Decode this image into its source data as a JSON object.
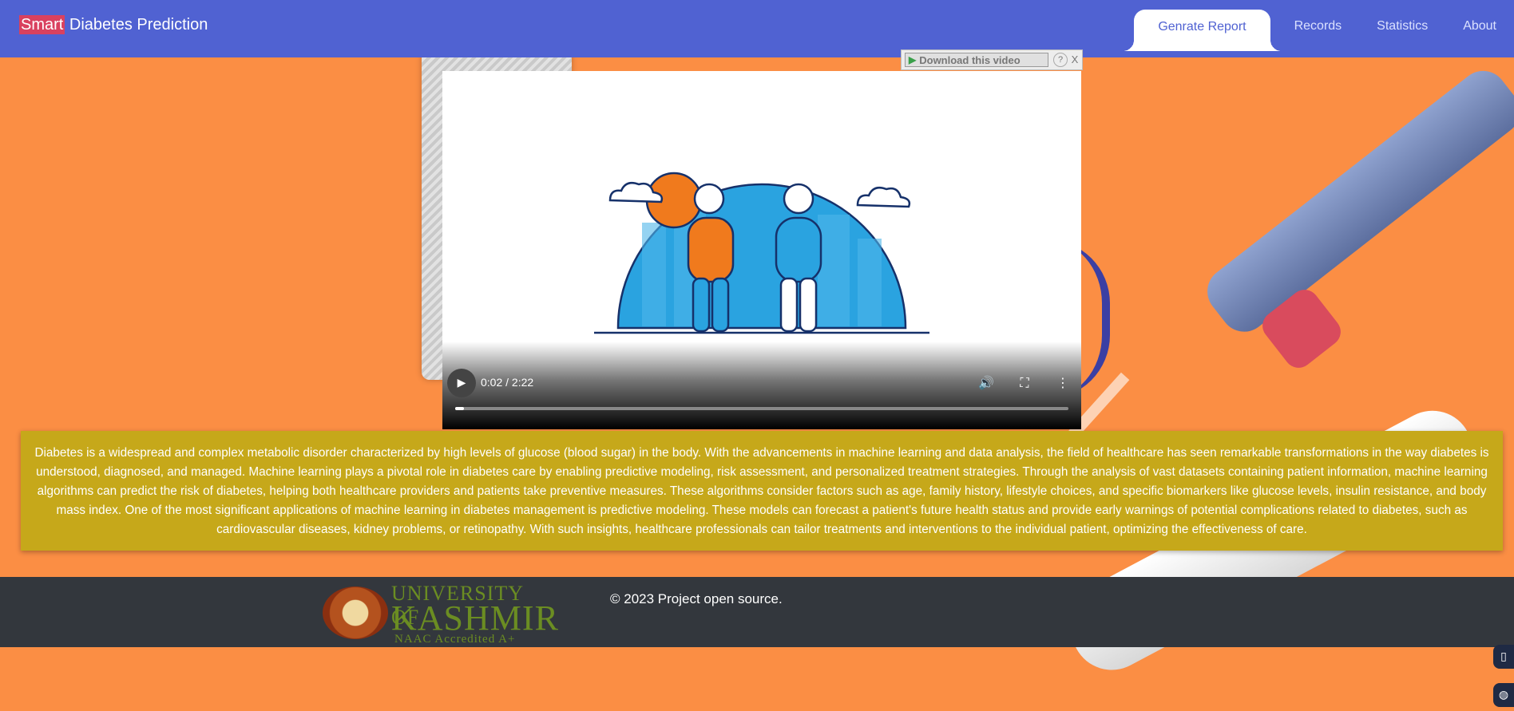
{
  "navbar": {
    "brand_highlight": "Smart",
    "brand_rest": " Diabetes Prediction",
    "items": [
      {
        "label": "Genrate Report",
        "active": true
      },
      {
        "label": "Records",
        "active": false
      },
      {
        "label": "Statistics",
        "active": false
      },
      {
        "label": "About",
        "active": false
      }
    ]
  },
  "download_bar": {
    "button_label": "Download this video",
    "help_label": "?",
    "close_label": "X"
  },
  "video": {
    "time": "0:02 / 2:22",
    "progress_fraction": 0.014
  },
  "info": {
    "text": "Diabetes is a widespread and complex metabolic disorder characterized by high levels of glucose (blood sugar) in the body. With the advancements in machine learning and data analysis, the field of healthcare has seen remarkable transformations in the way diabetes is understood, diagnosed, and managed. Machine learning plays a pivotal role in diabetes care by enabling predictive modeling, risk assessment, and personalized treatment strategies. Through the analysis of vast datasets containing patient information, machine learning algorithms can predict the risk of diabetes, helping both healthcare providers and patients take preventive measures. These algorithms consider factors such as age, family history, lifestyle choices, and specific biomarkers like glucose levels, insulin resistance, and body mass index. One of the most significant applications of machine learning in diabetes management is predictive modeling. These models can forecast a patient's future health status and provide early warnings of potential complications related to diabetes, such as cardiovascular diseases, kidney problems, or retinopathy. With such insights, healthcare professionals can tailor treatments and interventions to the individual patient, optimizing the effectiveness of care."
  },
  "footer": {
    "logo_line1": "UNIVERSITY OF",
    "logo_line2": "KASHMIR",
    "logo_line3": "NAAC Accredited A+",
    "copyright": "© 2023 Project open source."
  },
  "colors": {
    "navbar": "#5062d2",
    "brand_highlight": "#d9415f",
    "info_box": "#c6a81a",
    "footer": "#33373d",
    "page_background": "#fb8e44"
  }
}
